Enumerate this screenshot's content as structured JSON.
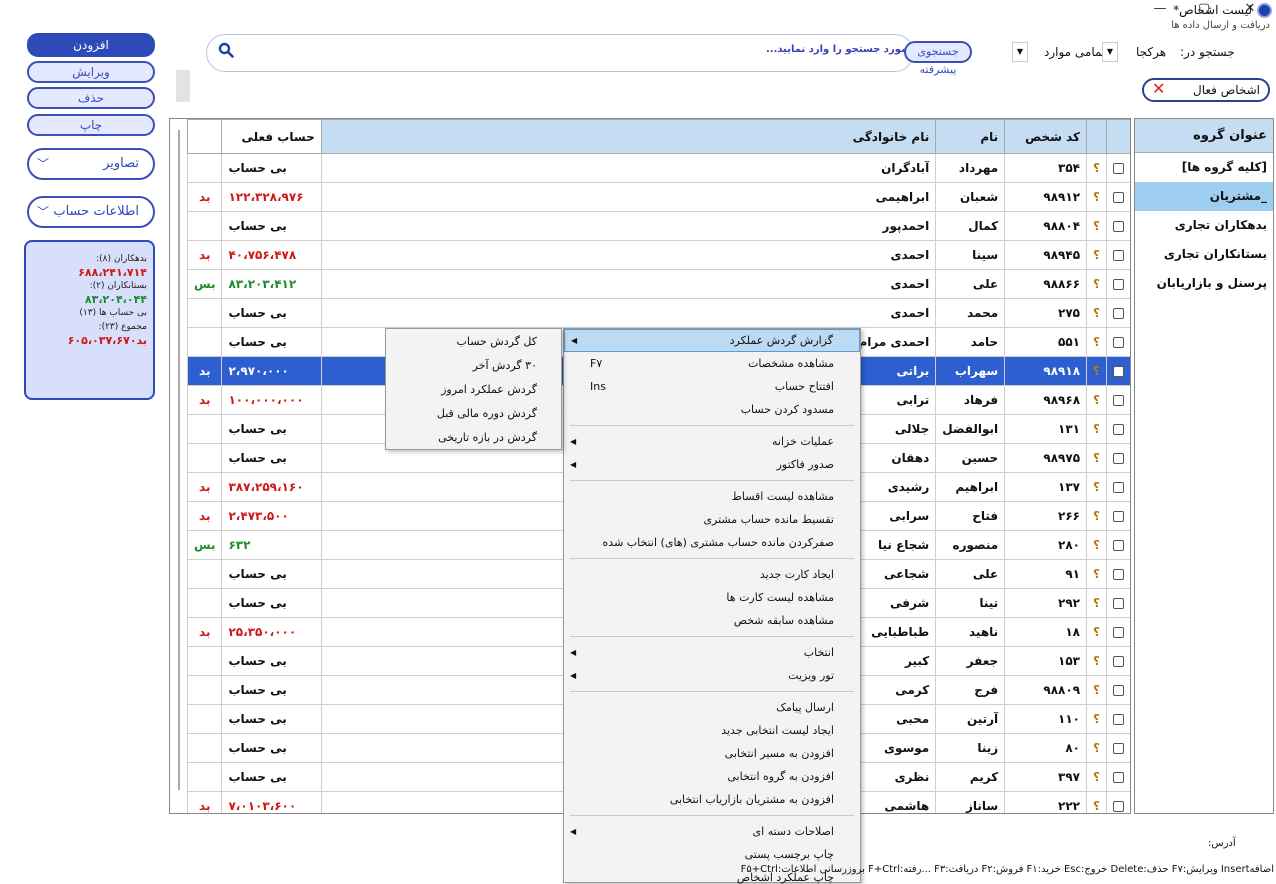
{
  "window": {
    "title": "لیست اشخاص*",
    "sync_text": "دریافت و ارسال داده ها",
    "minimize": "—",
    "maximize": "▢",
    "close": "✕"
  },
  "actions": {
    "add": "افزودن",
    "edit": "ویرایش",
    "delete": "حذف",
    "print": "چاپ",
    "images": "تصاویر",
    "account_info": "اطلاعات حساب"
  },
  "summary": {
    "debtors_label": "بدهکاران (۸):",
    "debtors_value": "۶۸۸،۲۴۱،۷۱۴",
    "creditors_label": "بستانکاران (۲):",
    "creditors_value": "۸۳،۲۰۴،۰۴۴",
    "no_account_label": "بی حساب ها (۱۳)",
    "total_label": "مجموع (۲۳):",
    "total_value": "بد۶۰۵،۰۳۷،۶۷۰"
  },
  "search": {
    "placeholder": "مورد جستجو را وارد نمایید...",
    "advanced": "جستجوی پیشرفته",
    "filter_value": "تمامی موارد",
    "search_in_label": "جستجو در:",
    "search_in_value": "هرکجا",
    "active_persons": "اشخاص فعال"
  },
  "groups": {
    "header": "عنوان گروه",
    "items": [
      {
        "label": "[کلیه گروه ها]",
        "selected": false
      },
      {
        "label": "_مشتریان",
        "selected": true
      },
      {
        "label": "بدهکاران تجاری",
        "selected": false
      },
      {
        "label": "بستانکاران تجاری",
        "selected": false
      },
      {
        "label": "پرسنل و بازاریابان",
        "selected": false
      }
    ]
  },
  "table": {
    "headers": {
      "code": "کد شخص",
      "name": "نام",
      "family": "نام خانوادگی",
      "balance": "حساب فعلی"
    },
    "rows": [
      {
        "code": "۳۵۴",
        "name": "مهرداد",
        "family": "آبادگران",
        "balance": "بی حساب",
        "flag": "",
        "tone": ""
      },
      {
        "code": "۹۸۹۱۲",
        "name": "شعبان",
        "family": "ابراهیمی",
        "balance": "۱۲۲،۳۲۸،۹۷۶",
        "flag": "بد",
        "tone": "red"
      },
      {
        "code": "۹۸۸۰۴",
        "name": "کمال",
        "family": "احمدپور",
        "balance": "بی حساب",
        "flag": "",
        "tone": ""
      },
      {
        "code": "۹۸۹۴۵",
        "name": "سینا",
        "family": "احمدی",
        "balance": "۴۰،۷۵۶،۴۷۸",
        "flag": "بد",
        "tone": "red"
      },
      {
        "code": "۹۸۸۶۶",
        "name": "علی",
        "family": "احمدی",
        "balance": "۸۳،۲۰۳،۴۱۲",
        "flag": "بس",
        "tone": "green"
      },
      {
        "code": "۲۷۵",
        "name": "محمد",
        "family": "احمدی",
        "balance": "بی حساب",
        "flag": "",
        "tone": ""
      },
      {
        "code": "۵۵۱",
        "name": "حامد",
        "family": "احمدی مرام",
        "balance": "بی حساب",
        "flag": "",
        "tone": ""
      },
      {
        "code": "۹۸۹۱۸",
        "name": "سهراب",
        "family": "براتی",
        "balance": "۲،۹۷۰،۰۰۰",
        "flag": "بد",
        "tone": "sel"
      },
      {
        "code": "۹۸۹۶۸",
        "name": "فرهاد",
        "family": "ترابی",
        "balance": "۱۰۰،۰۰۰،۰۰۰",
        "flag": "بد",
        "tone": "red"
      },
      {
        "code": "۱۳۱",
        "name": "ابوالفضل",
        "family": "جلالی",
        "balance": "بی حساب",
        "flag": "",
        "tone": ""
      },
      {
        "code": "۹۸۹۷۵",
        "name": "حسین",
        "family": "دهقان",
        "balance": "بی حساب",
        "flag": "",
        "tone": ""
      },
      {
        "code": "۱۳۷",
        "name": "ابراهیم",
        "family": "رشیدی",
        "balance": "۳۸۷،۲۵۹،۱۶۰",
        "flag": "بد",
        "tone": "red"
      },
      {
        "code": "۲۶۶",
        "name": "فتاح",
        "family": "سرابی",
        "balance": "۲،۴۷۳،۵۰۰",
        "flag": "بد",
        "tone": "red"
      },
      {
        "code": "۲۸۰",
        "name": "منصوره",
        "family": "شجاع نیا",
        "balance": "۶۳۲",
        "flag": "بس",
        "tone": "green"
      },
      {
        "code": "۹۱",
        "name": "علی",
        "family": "شجاعی",
        "balance": "بی حساب",
        "flag": "",
        "tone": ""
      },
      {
        "code": "۲۹۲",
        "name": "تینا",
        "family": "شرفی",
        "balance": "بی حساب",
        "flag": "",
        "tone": ""
      },
      {
        "code": "۱۸",
        "name": "ناهید",
        "family": "طباطبایی",
        "balance": "۲۵،۳۵۰،۰۰۰",
        "flag": "بد",
        "tone": "red"
      },
      {
        "code": "۱۵۳",
        "name": "جعفر",
        "family": "کبیر",
        "balance": "بی حساب",
        "flag": "",
        "tone": ""
      },
      {
        "code": "۹۸۸۰۹",
        "name": "فرج",
        "family": "کرمی",
        "balance": "بی حساب",
        "flag": "",
        "tone": ""
      },
      {
        "code": "۱۱۰",
        "name": "آرتین",
        "family": "محبی",
        "balance": "بی حساب",
        "flag": "",
        "tone": ""
      },
      {
        "code": "۸۰",
        "name": "زینا",
        "family": "موسوی",
        "balance": "بی حساب",
        "flag": "",
        "tone": ""
      },
      {
        "code": "۳۹۷",
        "name": "کریم",
        "family": "نظری",
        "balance": "بی حساب",
        "flag": "",
        "tone": ""
      },
      {
        "code": "۲۲۲",
        "name": "ساناز",
        "family": "هاشمی",
        "balance": "۷،۰۱۰۳،۶۰۰",
        "flag": "بد",
        "tone": "red"
      }
    ]
  },
  "context_menu": {
    "items": [
      {
        "label": "گزارش گردش عملکرد",
        "sub": true,
        "highlight": true
      },
      {
        "label": "مشاهده مشخصات",
        "shortcut": "F۷"
      },
      {
        "label": "افتتاح حساب",
        "shortcut": "Ins"
      },
      {
        "label": "مسدود کردن حساب"
      },
      {
        "sep": true
      },
      {
        "label": "عملیات خزانه",
        "sub": true
      },
      {
        "label": "صدور فاکتور",
        "sub": true
      },
      {
        "sep": true
      },
      {
        "label": "مشاهده لیست اقساط"
      },
      {
        "label": "تقسیط مانده حساب مشتری"
      },
      {
        "label": "صفرکردن مانده حساب مشتری (های) انتخاب شده"
      },
      {
        "sep": true
      },
      {
        "label": "ایجاد کارت جدید"
      },
      {
        "label": "مشاهده لیست کارت ها"
      },
      {
        "label": "مشاهده سابقه شخص"
      },
      {
        "sep": true
      },
      {
        "label": "انتخاب",
        "sub": true
      },
      {
        "label": "تور ویزیت",
        "sub": true
      },
      {
        "sep": true
      },
      {
        "label": "ارسال پیامک"
      },
      {
        "label": "ایجاد لیست انتخابی جدید"
      },
      {
        "label": "افزودن به مسیر انتخابی"
      },
      {
        "label": "افزودن به گروه انتخابی"
      },
      {
        "label": "افزودن به مشتریان بازاریاب انتخابی"
      },
      {
        "sep": true
      },
      {
        "label": "اصلاحات دسته ای",
        "sub": true
      },
      {
        "label": "چاپ برچسب پستی"
      },
      {
        "label": "چاپ عملکرد اشخاص"
      }
    ]
  },
  "sub_menu": {
    "items": [
      "کل گردش حساب",
      "۳۰ گردش آخر",
      "گردش عملکرد امروز",
      "گردش دوره مالی قبل",
      "گردش در بازه تاریخی"
    ]
  },
  "footer": {
    "address_label": "آدرس:",
    "shortcuts": "اضافهInsert ویرایش:F۷ حذف:Delete خروج:Esc خرید:F۱ فروش:F۲ دریافت:F۳ ...رفته:F+Ctrl بروزرسانی اطلاعات:F۵+Ctrl"
  }
}
